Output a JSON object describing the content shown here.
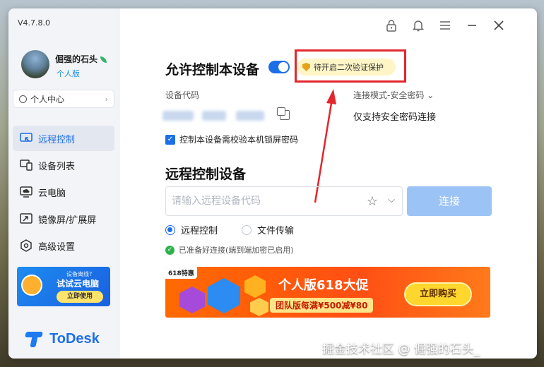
{
  "app": {
    "version": "V4.7.8.0",
    "brand": "ToDesk"
  },
  "user": {
    "name": "倔强的石头",
    "plan": "个人版",
    "center_label": "个人中心"
  },
  "nav": {
    "items": [
      {
        "label": "远程控制",
        "icon": "monitor-remote-icon",
        "active": true
      },
      {
        "label": "设备列表",
        "icon": "devices-icon",
        "active": false
      },
      {
        "label": "云电脑",
        "icon": "cloud-pc-icon",
        "active": false
      },
      {
        "label": "镜像屏/扩展屏",
        "icon": "mirror-screen-icon",
        "active": false
      },
      {
        "label": "高级设置",
        "icon": "settings-hex-icon",
        "active": false
      }
    ]
  },
  "promo_left": {
    "question": "设备离线?",
    "title": "试试云电脑",
    "button": "立即使用"
  },
  "allow": {
    "title": "允许控制本设备",
    "toggle_on": true,
    "verify_badge": "待开启二次验证保护",
    "device_code_label": "设备代码",
    "connect_mode_label": "连接模式-安全密码",
    "connect_mode_value": "仅支持安全密码连接",
    "lock_check_label": "控制本设备需校验本机锁屏密码",
    "lock_check_checked": true
  },
  "remote": {
    "title": "远程控制设备",
    "input_placeholder": "请输入远程设备代码",
    "connect_button": "连接",
    "options": [
      {
        "label": "远程控制",
        "selected": true
      },
      {
        "label": "文件传输",
        "selected": false
      }
    ],
    "status_text": "已准备好连接(端到端加密已启用)"
  },
  "banner": {
    "tag": "618特惠",
    "headline": "个人版618大促",
    "subline": "团队版每满¥500减¥80",
    "button": "立即购买"
  },
  "watermark": "掘金技术社区 @ 倔强的石头_",
  "colors": {
    "accent": "#1d6fe8",
    "highlight_box": "#e4262d",
    "banner": "#ff5a10"
  }
}
